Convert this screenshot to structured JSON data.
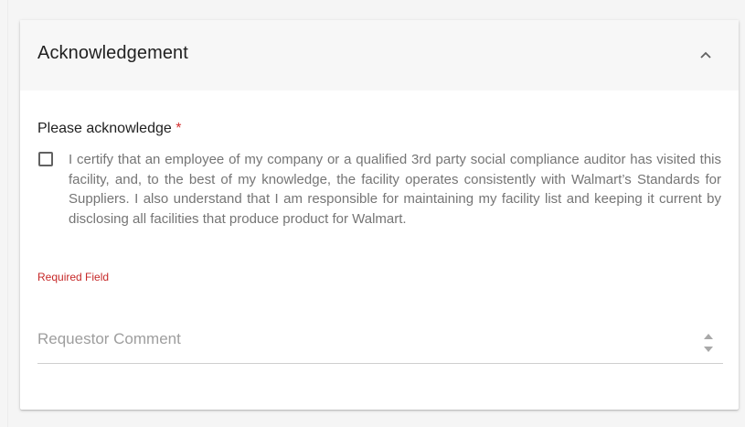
{
  "card": {
    "title": "Acknowledgement",
    "collapse_icon": "chevron-up-icon"
  },
  "acknowledge": {
    "label": "Please acknowledge",
    "required_marker": "*",
    "checked": false,
    "text": "I certify that an employee of my company or a qualified 3rd party social compliance auditor has visited this facility, and, to the best of my knowledge, the facility operates consistently with Walmart’s Standards for Suppliers. I also understand that I am responsible for maintaining my facility list and keeping it current by disclosing all facilities that produce product for Walmart.",
    "error": "Required Field"
  },
  "comment": {
    "placeholder": "Requestor Comment",
    "value": ""
  },
  "colors": {
    "required": "#d32f2f",
    "error": "#c62828",
    "header_bg": "#f7f7f7"
  }
}
